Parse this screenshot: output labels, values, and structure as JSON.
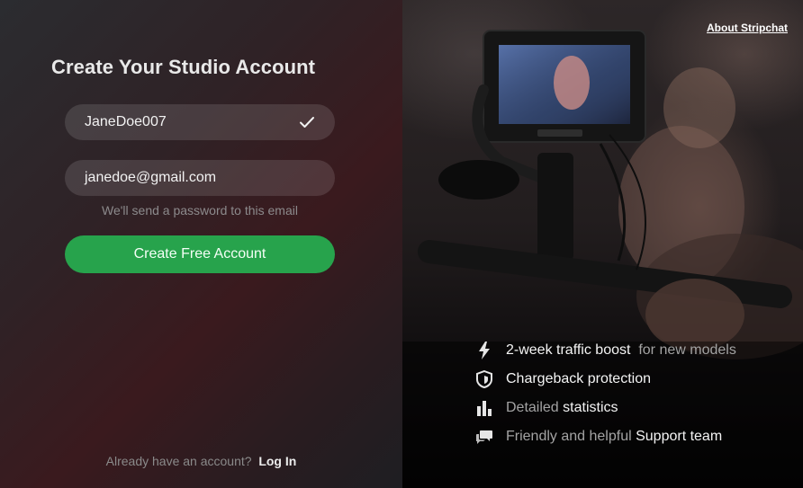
{
  "signup": {
    "title": "Create Your Studio Account",
    "username_value": "JaneDoe007",
    "email_value": "janedoe@gmail.com",
    "email_hint": "We'll send a password to this email",
    "cta_label": "Create Free Account",
    "login_prompt": "Already have an account?",
    "login_link": "Log In"
  },
  "header": {
    "about_link": "About Stripchat"
  },
  "colors": {
    "accent_green": "#27a34c",
    "left_panel": "#2f2226"
  },
  "features": [
    {
      "icon": "lightning-icon",
      "strong": "2-week traffic boost",
      "rest": " for new models"
    },
    {
      "icon": "shield-icon",
      "strong": "Chargeback protection",
      "rest": ""
    },
    {
      "icon": "bar-chart-icon",
      "pre": "Detailed ",
      "strong": "statistics"
    },
    {
      "icon": "chat-bubbles-icon",
      "pre": "Friendly and helpful ",
      "strong": "Support team"
    }
  ]
}
